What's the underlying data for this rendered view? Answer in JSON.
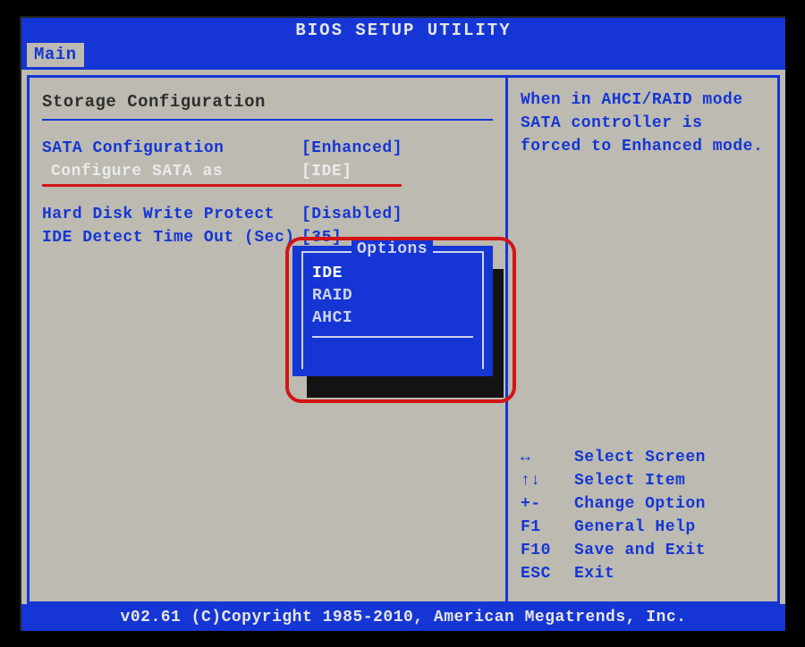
{
  "title": "BIOS SETUP UTILITY",
  "tab": "Main",
  "section_title": "Storage Configuration",
  "rows": {
    "sata_cfg": {
      "label": "SATA Configuration",
      "value": "[Enhanced]"
    },
    "cfg_as": {
      "label": "Configure SATA as",
      "value": "[IDE]"
    },
    "hd_protect": {
      "label": "Hard Disk Write Protect",
      "value": "[Disabled]"
    },
    "ide_to": {
      "label": "IDE Detect Time Out (Sec)",
      "value": "[35]"
    }
  },
  "popup": {
    "title": "Options",
    "items": [
      "IDE",
      "RAID",
      "AHCI"
    ],
    "selected_index": 0
  },
  "help_text": "When in AHCI/RAID mode SATA controller is forced to Enhanced mode.",
  "keys": [
    {
      "k": "↔",
      "d": "Select Screen"
    },
    {
      "k": "↑↓",
      "d": "Select Item"
    },
    {
      "k": "+-",
      "d": "Change Option"
    },
    {
      "k": "F1",
      "d": "General Help"
    },
    {
      "k": "F10",
      "d": "Save and Exit"
    },
    {
      "k": "ESC",
      "d": "Exit"
    }
  ],
  "footer": "v02.61 (C)Copyright 1985-2010, American Megatrends, Inc."
}
